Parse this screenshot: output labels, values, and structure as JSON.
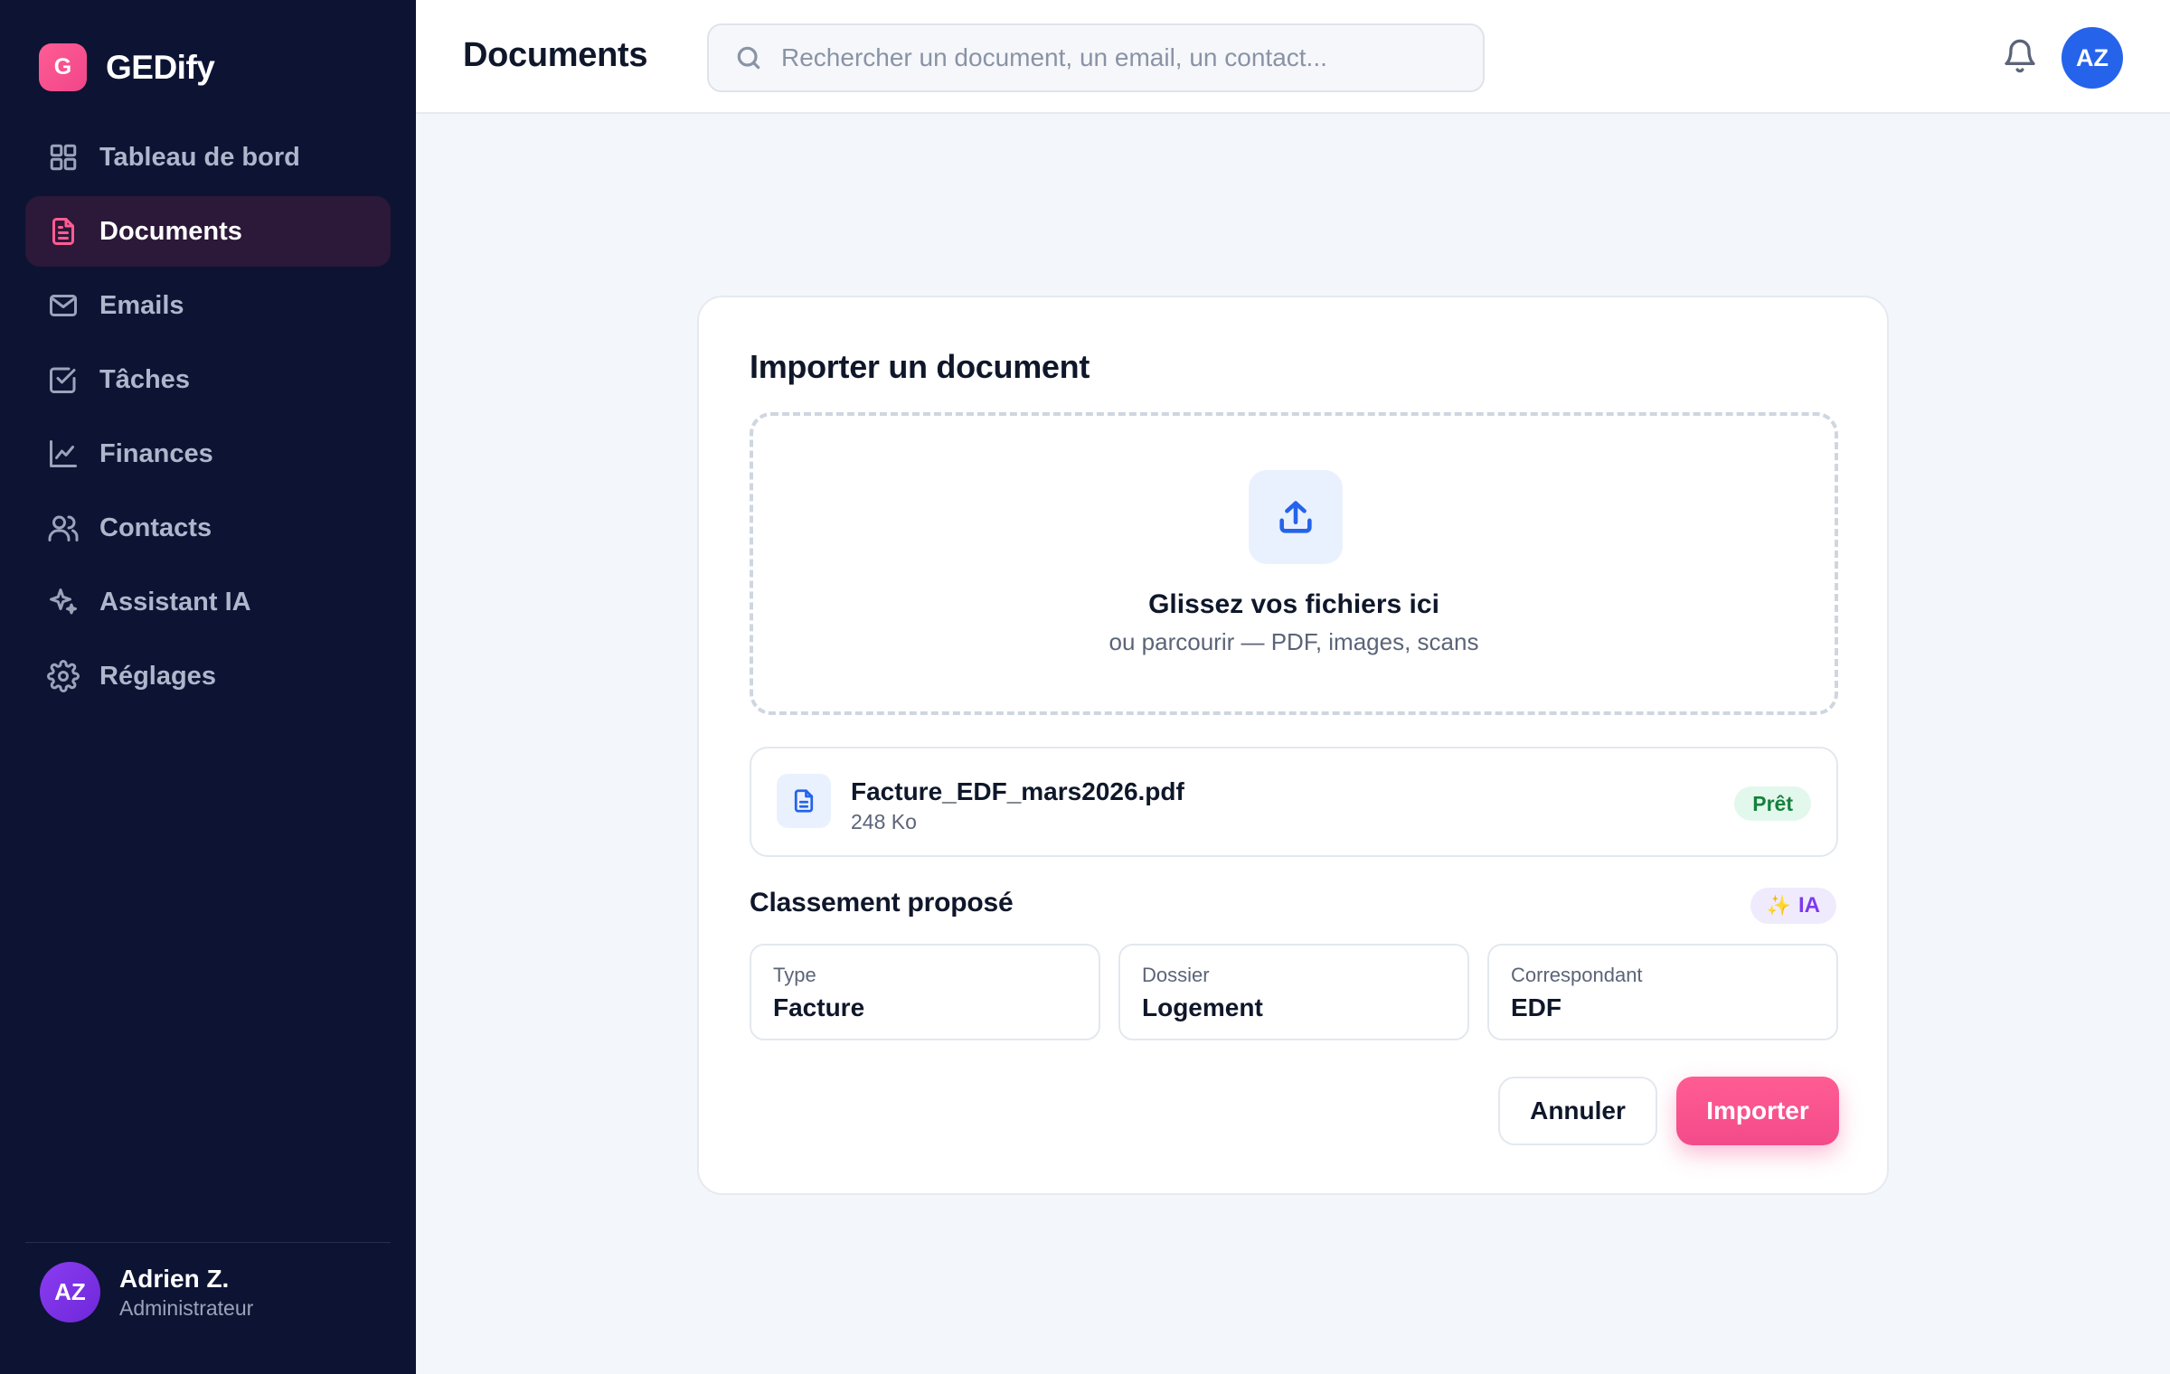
{
  "brand": {
    "logo_letter": "G",
    "name": "GEDify"
  },
  "sidebar": {
    "items": [
      {
        "label": "Tableau de bord",
        "icon": "grid-icon",
        "active": false
      },
      {
        "label": "Documents",
        "icon": "document-icon",
        "active": true
      },
      {
        "label": "Emails",
        "icon": "mail-icon",
        "active": false
      },
      {
        "label": "Tâches",
        "icon": "checkbox-icon",
        "active": false
      },
      {
        "label": "Finances",
        "icon": "chart-line-icon",
        "active": false
      },
      {
        "label": "Contacts",
        "icon": "users-icon",
        "active": false
      },
      {
        "label": "Assistant IA",
        "icon": "sparkle-icon",
        "active": false
      },
      {
        "label": "Réglages",
        "icon": "gear-icon",
        "active": false
      }
    ]
  },
  "user": {
    "initials": "AZ",
    "name": "Adrien Z.",
    "role": "Administrateur"
  },
  "header": {
    "title": "Documents",
    "search_placeholder": "Rechercher un document, un email, un contact...",
    "avatar_initials": "AZ"
  },
  "upload_card": {
    "title": "Importer un document",
    "dropzone": {
      "title": "Glissez vos fichiers ici",
      "subtitle": "ou parcourir — PDF, images, scans"
    },
    "file": {
      "name": "Facture_EDF_mars2026.pdf",
      "size": "248 Ko",
      "status": "Prêt"
    },
    "classification": {
      "title": "Classement proposé",
      "ai_badge": "IA",
      "ai_badge_icon": "✨",
      "fields": [
        {
          "label": "Type",
          "value": "Facture"
        },
        {
          "label": "Dossier",
          "value": "Logement"
        },
        {
          "label": "Correspondant",
          "value": "EDF"
        }
      ]
    },
    "buttons": {
      "cancel": "Annuler",
      "import": "Importer"
    }
  },
  "colors": {
    "sidebar_bg": "#0d1333",
    "accent": "#ff5c93",
    "primary_blue": "#2563eb",
    "success": "#15803d",
    "ai_purple": "#7c3aed"
  }
}
